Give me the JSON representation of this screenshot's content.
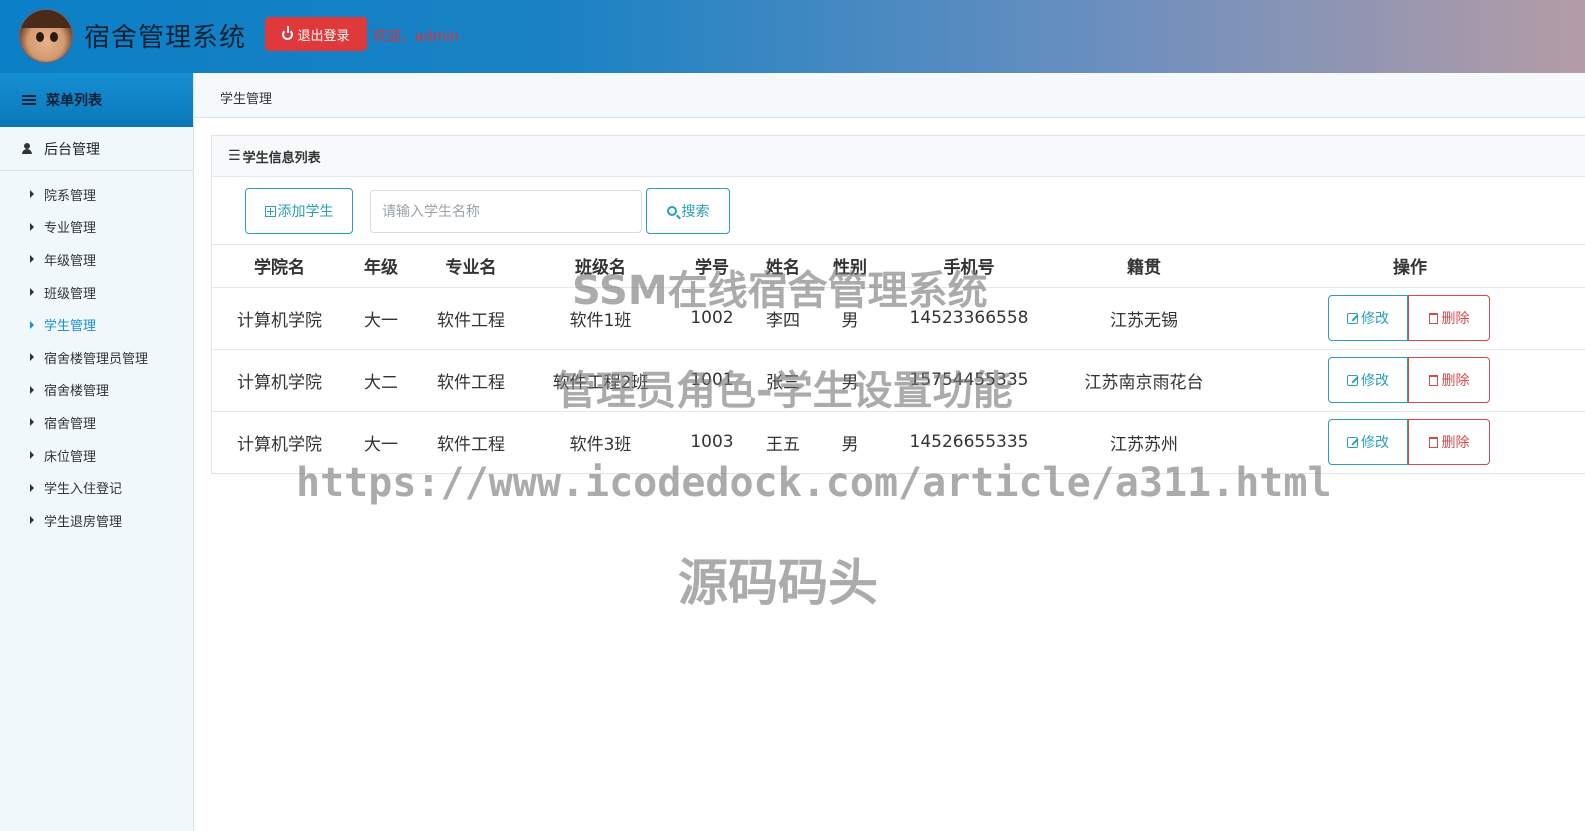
{
  "header": {
    "title": "宿舍管理系统",
    "logout_label": "退出登录",
    "welcome": "欢迎，admin"
  },
  "sidebar": {
    "menu_title": "菜单列表",
    "group_title": "后台管理",
    "items": [
      {
        "label": "院系管理"
      },
      {
        "label": "专业管理"
      },
      {
        "label": "年级管理"
      },
      {
        "label": "班级管理"
      },
      {
        "label": "学生管理"
      },
      {
        "label": "宿舍楼管理员管理"
      },
      {
        "label": "宿舍楼管理"
      },
      {
        "label": "宿舍管理"
      },
      {
        "label": "床位管理"
      },
      {
        "label": "学生入住登记"
      },
      {
        "label": "学生退房管理"
      }
    ],
    "active_index": 4
  },
  "breadcrumb": "学生管理",
  "panel": {
    "title": "学生信息列表",
    "add_label": "添加学生",
    "search_placeholder": "请输入学生名称",
    "search_label": "搜索"
  },
  "table": {
    "columns": [
      "学院名",
      "年级",
      "专业名",
      "班级名",
      "学号",
      "姓名",
      "性别",
      "手机号",
      "籍贯",
      "操作"
    ],
    "rows": [
      [
        "计算机学院",
        "大一",
        "软件工程",
        "软件1班",
        "1002",
        "李四",
        "男",
        "14523366558",
        "江苏无锡"
      ],
      [
        "计算机学院",
        "大二",
        "软件工程",
        "软件工程2班",
        "1001",
        "张三",
        "男",
        "15754455335",
        "江苏南京雨花台"
      ],
      [
        "计算机学院",
        "大一",
        "软件工程",
        "软件3班",
        "1003",
        "王五",
        "男",
        "14526655335",
        "江苏苏州"
      ]
    ],
    "edit_label": "修改",
    "delete_label": "删除"
  },
  "watermark": {
    "line1": "SSM在线宿舍管理系统",
    "line2": "管理员角色-学生设置功能",
    "line3": "https://www.icodedock.com/article/a311.html",
    "line4": "源码码头"
  },
  "colors": {
    "accent": "#2a9fb6",
    "danger": "#d64a4a",
    "logout": "#e0393b",
    "active_nav": "#1a8fd8"
  }
}
